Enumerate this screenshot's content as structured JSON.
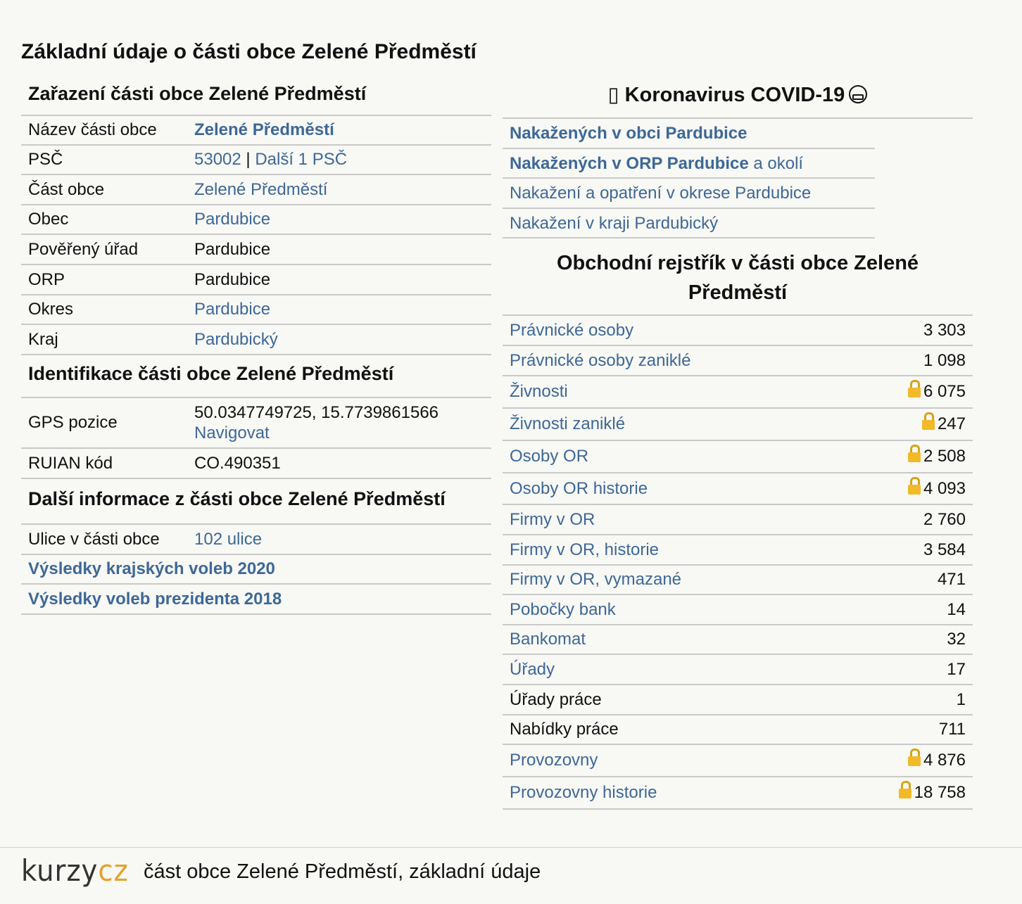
{
  "page_title": "Základní údaje o části obce Zelené Předměstí",
  "zarazeni": {
    "heading": "Zařazení části obce Zelené Předměstí",
    "rows": [
      {
        "label": "Název části obce",
        "value": "Zelené Předměstí",
        "link": true,
        "bold": true
      },
      {
        "label": "PSČ",
        "value": "53002",
        "sep": " | ",
        "value2": "Další 1 PSČ",
        "link": true
      },
      {
        "label": "Část obce",
        "value": "Zelené Předměstí",
        "link": true
      },
      {
        "label": "Obec",
        "value": "Pardubice",
        "link": true
      },
      {
        "label": "Pověřený úřad",
        "value": "Pardubice",
        "link": false
      },
      {
        "label": "ORP",
        "value": "Pardubice",
        "link": false
      },
      {
        "label": "Okres",
        "value": "Pardubice",
        "link": true
      },
      {
        "label": "Kraj",
        "value": "Pardubický",
        "link": true
      }
    ]
  },
  "identifikace": {
    "heading": "Identifikace části obce Zelené Předměstí",
    "gps_label": "GPS pozice",
    "gps_value": "50.0347749725, 15.7739861566",
    "gps_nav": "Navigovat",
    "ruian_label": "RUIAN kód",
    "ruian_value": "CO.490351"
  },
  "dalsi": {
    "heading": "Další informace z části obce Zelené Předměstí",
    "ulice_label": "Ulice v části obce",
    "ulice_value": "102 ulice",
    "links": [
      "Výsledky krajských voleb 2020",
      "Výsledky voleb prezidenta 2018"
    ]
  },
  "covid": {
    "heading_glyph": "▯",
    "heading": "Koronavirus COVID-19",
    "heading_icon": "face-mask-icon",
    "rows": [
      {
        "bold": "Nakažených v obci Pardubice",
        "rest": ""
      },
      {
        "bold": "Nakažených v ORP Pardubice",
        "rest": " a okolí"
      },
      {
        "bold": "",
        "rest": "Nakažení a opatření v okrese Pardubice"
      },
      {
        "bold": "",
        "rest": "Nakažení v kraji Pardubický"
      }
    ]
  },
  "obchodni": {
    "heading": "Obchodní rejstřík v části obce Zelené Předměstí",
    "rows": [
      {
        "label": "Právnické osoby",
        "value": "3 303",
        "link": true,
        "lock": false
      },
      {
        "label": "Právnické osoby zaniklé",
        "value": "1 098",
        "link": true,
        "lock": false
      },
      {
        "label": "Živnosti",
        "value": "6 075",
        "link": true,
        "lock": true
      },
      {
        "label": "Živnosti zaniklé",
        "value": "247",
        "link": true,
        "lock": true
      },
      {
        "label": "Osoby OR",
        "value": "2 508",
        "link": true,
        "lock": true
      },
      {
        "label": "Osoby OR historie",
        "value": "4 093",
        "link": true,
        "lock": true
      },
      {
        "label": "Firmy v OR",
        "value": "2 760",
        "link": true,
        "lock": false
      },
      {
        "label": "Firmy v OR, historie",
        "value": "3 584",
        "link": true,
        "lock": false
      },
      {
        "label": "Firmy v OR, vymazané",
        "value": "471",
        "link": true,
        "lock": false
      },
      {
        "label": "Pobočky bank",
        "value": "14",
        "link": true,
        "lock": false
      },
      {
        "label": "Bankomat",
        "value": "32",
        "link": true,
        "lock": false
      },
      {
        "label": "Úřady",
        "value": "17",
        "link": true,
        "lock": false
      },
      {
        "label": "Úřady práce",
        "value": "1",
        "link": false,
        "lock": false
      },
      {
        "label": "Nabídky práce",
        "value": "711",
        "link": false,
        "lock": false
      },
      {
        "label": "Provozovny",
        "value": "4 876",
        "link": true,
        "lock": true
      },
      {
        "label": "Provozovny historie",
        "value": "18 758",
        "link": true,
        "lock": true
      }
    ]
  },
  "footer": {
    "logo_part1": "kurzy",
    "logo_part2": "cz",
    "caption": "část obce Zelené Předměstí, základní údaje"
  },
  "colors": {
    "link": "#3d6896",
    "logo_accent": "#e0a32b",
    "lock": "#f2b928"
  }
}
